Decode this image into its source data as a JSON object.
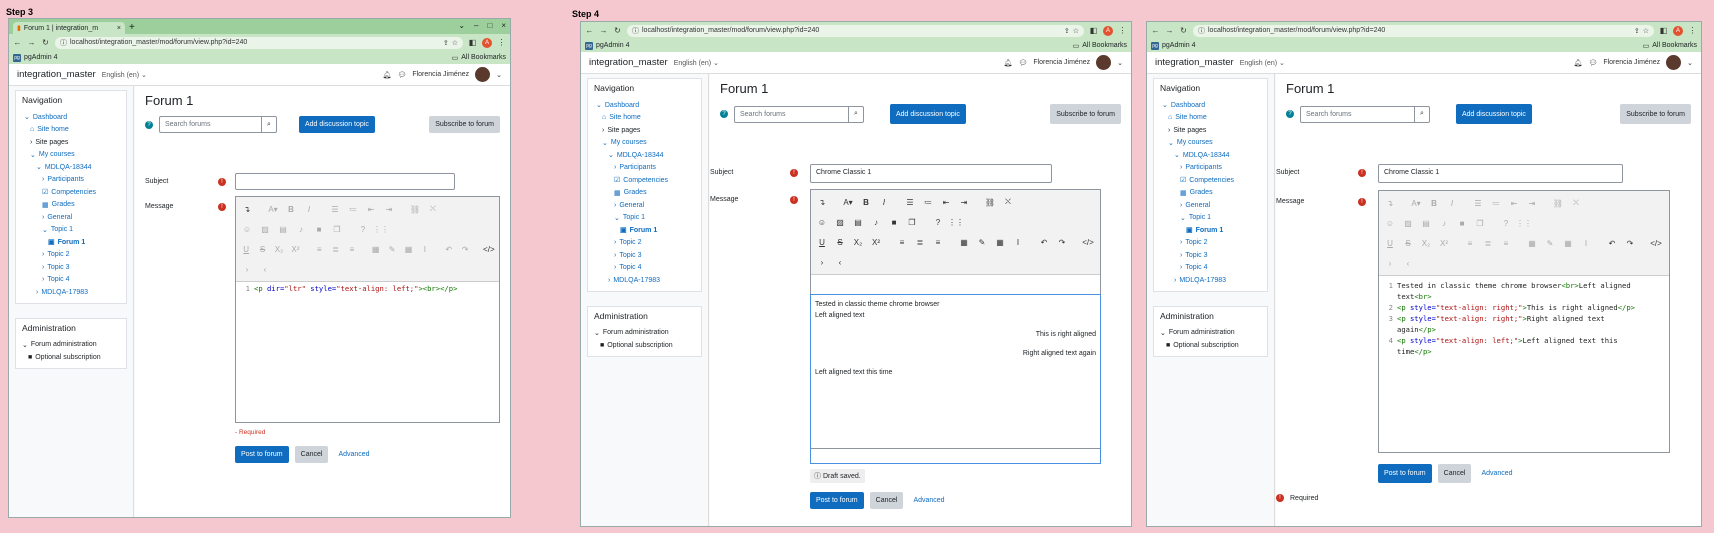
{
  "steps": [
    {
      "label": "Step 3",
      "browser": {
        "tab_title": "Forum 1 | integration_m",
        "url": "localhost/integration_master/mod/forum/view.php?id=240",
        "bookmark": "pgAdmin 4",
        "all_bookmarks": "All Bookmarks"
      },
      "moodle": {
        "site": "integration_master",
        "lang": "English (en) ⌄",
        "user": "Florencia Jiménez"
      },
      "nav": {
        "title": "Navigation",
        "items": [
          "Dashboard",
          "Site home",
          "Site pages",
          "My courses",
          "MDLQA-18344",
          "Participants",
          "Competencies",
          "Grades",
          "General",
          "Topic 1",
          "Forum 1",
          "Topic 2",
          "Topic 3",
          "Topic 4",
          "MDLQA-17983"
        ]
      },
      "admin": {
        "title": "Administration",
        "items": [
          "Forum administration",
          "Optional subscription"
        ]
      },
      "page": {
        "title": "Forum 1",
        "search_placeholder": "Search forums",
        "add_btn": "Add discussion topic",
        "subscribe_btn": "Subscribe to forum",
        "subject_label": "Subject",
        "subject_value": "",
        "message_label": "Message",
        "code_lines": [
          {
            "num": "1",
            "parts": [
              [
                "tag",
                "<p "
              ],
              [
                "attr",
                "dir="
              ],
              [
                "str",
                "\"ltr\""
              ],
              [
                "attr",
                " style="
              ],
              [
                "str",
                "\"text-align: left;\""
              ],
              [
                "tag",
                "><br></p>"
              ]
            ]
          }
        ],
        "required": "Required",
        "post_btn": "Post to forum",
        "cancel_btn": "Cancel",
        "advanced": "Advanced"
      }
    },
    {
      "label": "Step 4",
      "browser": {
        "url": "localhost/integration_master/mod/forum/view.php?id=240",
        "bookmark": "pgAdmin 4",
        "all_bookmarks": "All Bookmarks"
      },
      "moodle": {
        "site": "integration_master",
        "lang": "English (en) ⌄",
        "user": "Florencia Jiménez"
      },
      "nav": {
        "title": "Navigation",
        "items": [
          "Dashboard",
          "Site home",
          "Site pages",
          "My courses",
          "MDLQA-18344",
          "Participants",
          "Competencies",
          "Grades",
          "General",
          "Topic 1",
          "Forum 1",
          "Topic 2",
          "Topic 3",
          "Topic 4",
          "MDLQA-17983"
        ]
      },
      "admin": {
        "title": "Administration",
        "items": [
          "Forum administration",
          "Optional subscription"
        ]
      },
      "page": {
        "title": "Forum 1",
        "search_placeholder": "Search forums",
        "add_btn": "Add discussion topic",
        "subscribe_btn": "Subscribe to forum",
        "subject_label": "Subject",
        "subject_value": "Chrome Classic 1",
        "message_label": "Message",
        "message_lines": [
          {
            "text": "Tested in classic theme chrome browser",
            "align": "left"
          },
          {
            "text": "Left aligned text",
            "align": "left"
          },
          {
            "text": "This is right aligned",
            "align": "right"
          },
          {
            "text": "Right aligned text again",
            "align": "right"
          },
          {
            "text": "Left aligned text this time",
            "align": "left"
          }
        ],
        "draft": "Draft saved.",
        "post_btn": "Post to forum",
        "cancel_btn": "Cancel",
        "advanced": "Advanced"
      }
    },
    {
      "label": "",
      "browser": {
        "url": "localhost/integration_master/mod/forum/view.php?id=240",
        "bookmark": "pgAdmin 4",
        "all_bookmarks": "All Bookmarks"
      },
      "moodle": {
        "site": "integration_master",
        "lang": "English (en) ⌄",
        "user": "Florencia Jiménez"
      },
      "nav": {
        "title": "Navigation",
        "items": [
          "Dashboard",
          "Site home",
          "Site pages",
          "My courses",
          "MDLQA-18344",
          "Participants",
          "Competencies",
          "Grades",
          "General",
          "Topic 1",
          "Forum 1",
          "Topic 2",
          "Topic 3",
          "Topic 4",
          "MDLQA-17983"
        ]
      },
      "admin": {
        "title": "Administration",
        "items": [
          "Forum administration",
          "Optional subscription"
        ]
      },
      "page": {
        "title": "Forum 1",
        "search_placeholder": "Search forums",
        "add_btn": "Add discussion topic",
        "subscribe_btn": "Subscribe to forum",
        "subject_label": "Subject",
        "subject_value": "Chrome Classic 1",
        "message_label": "Message",
        "code_lines": [
          {
            "num": "1",
            "parts": [
              [
                "txt",
                "Tested in classic theme chrome browser"
              ],
              [
                "tag",
                "<br>"
              ],
              [
                "txt",
                "Left aligned"
              ]
            ]
          },
          {
            "num": "",
            "parts": [
              [
                "txt",
                "text"
              ],
              [
                "tag",
                "<br>"
              ]
            ]
          },
          {
            "num": "2",
            "parts": [
              [
                "tag",
                "<p "
              ],
              [
                "attr",
                "style="
              ],
              [
                "str",
                "\"text-align: right;\""
              ],
              [
                "tag",
                ">"
              ],
              [
                "txt",
                "This is right aligned"
              ],
              [
                "tag",
                "</p>"
              ]
            ]
          },
          {
            "num": "3",
            "parts": [
              [
                "tag",
                "<p "
              ],
              [
                "attr",
                "style="
              ],
              [
                "str",
                "\"text-align: right;\""
              ],
              [
                "tag",
                ">"
              ],
              [
                "txt",
                "Right aligned text"
              ]
            ]
          },
          {
            "num": "",
            "parts": [
              [
                "txt",
                "again"
              ],
              [
                "tag",
                "</p>"
              ]
            ]
          },
          {
            "num": "4",
            "parts": [
              [
                "tag",
                "<p "
              ],
              [
                "attr",
                "style="
              ],
              [
                "str",
                "\"text-align: left;\""
              ],
              [
                "tag",
                ">"
              ],
              [
                "txt",
                "Left aligned text this"
              ]
            ]
          },
          {
            "num": "",
            "parts": [
              [
                "txt",
                "time"
              ],
              [
                "tag",
                "</p>"
              ]
            ]
          }
        ],
        "post_btn": "Post to forum",
        "cancel_btn": "Cancel",
        "advanced": "Advanced",
        "required": "Required"
      }
    }
  ]
}
